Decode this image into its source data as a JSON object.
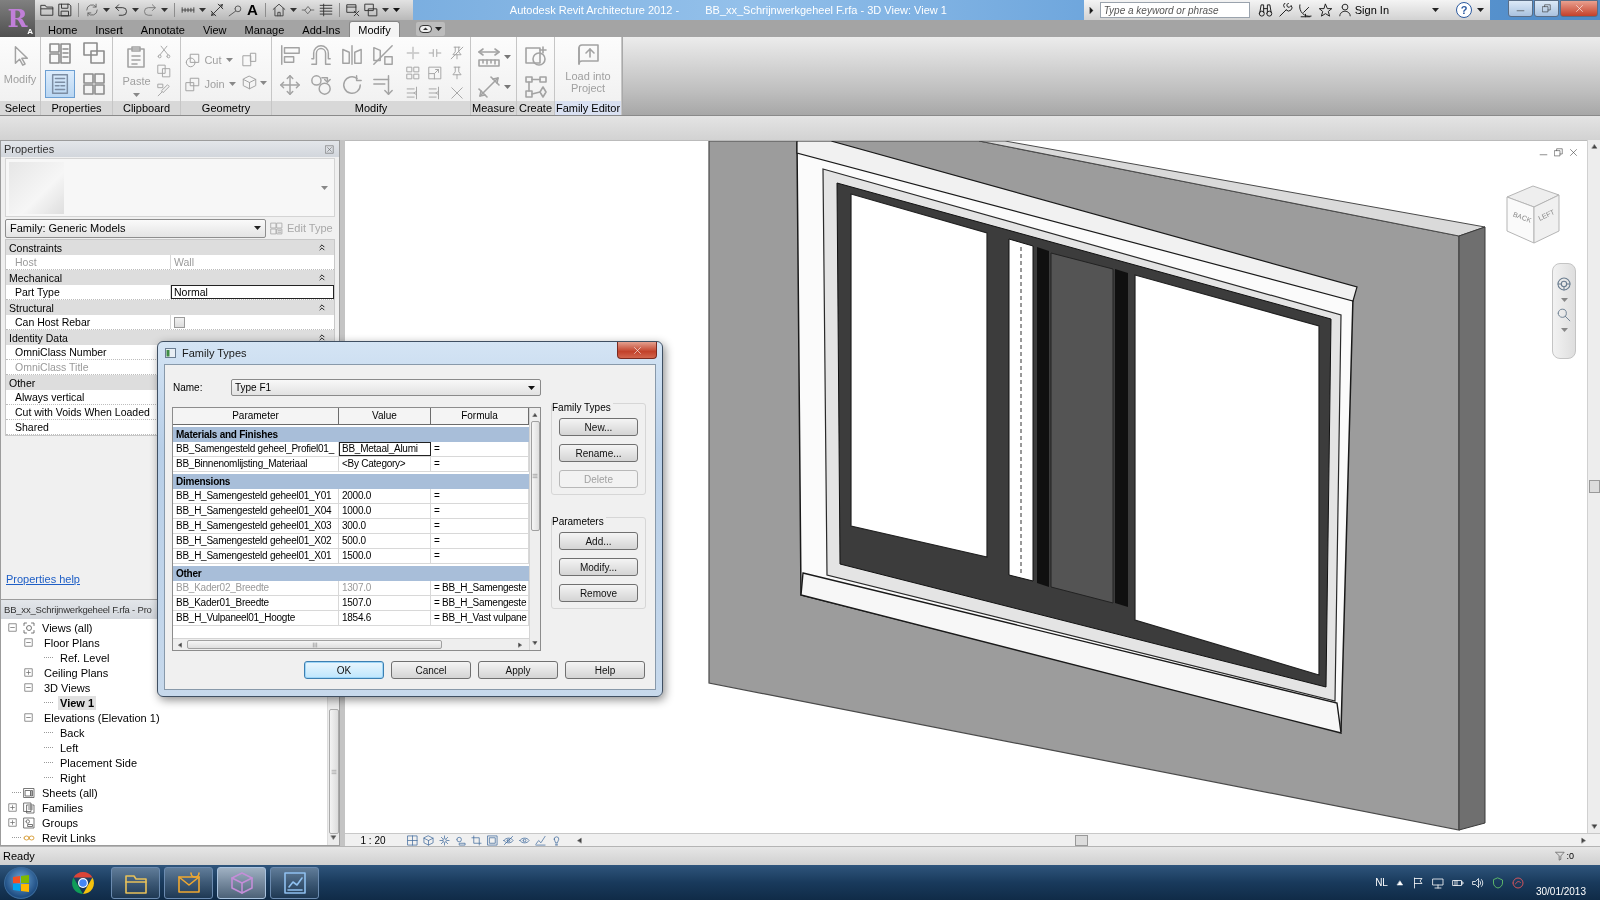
{
  "app_button": {
    "logo": "R",
    "key_tip": "A"
  },
  "quick_access": {
    "text_tool": "A"
  },
  "window": {
    "title_app": "Autodesk Revit Architecture 2012 -",
    "title_document": "BB_xx_Schrijnwerkgeheel F.rfa - 3D View: View 1"
  },
  "info_center": {
    "search": {
      "placeholder": "Type a keyword or phrase"
    },
    "sign_in": "Sign In",
    "help_symbol": "?"
  },
  "ribbon": {
    "tabs": [
      {
        "label": "Home",
        "selected": false
      },
      {
        "label": "Insert",
        "selected": false
      },
      {
        "label": "Annotate",
        "selected": false
      },
      {
        "label": "View",
        "selected": false
      },
      {
        "label": "Manage",
        "selected": false
      },
      {
        "label": "Add-Ins",
        "selected": false
      },
      {
        "label": "Modify",
        "selected": true
      }
    ],
    "panels": [
      {
        "label": "Select",
        "kind": "select",
        "contextual": false,
        "tools": [
          {
            "label": "Modify",
            "disabled": true
          }
        ]
      },
      {
        "label": "Properties",
        "kind": "properties",
        "contextual": false,
        "toggle_on": true
      },
      {
        "label": "Clipboard",
        "kind": "clipboard",
        "contextual": false,
        "tools": [
          {
            "label": "Paste",
            "disabled": true
          }
        ]
      },
      {
        "label": "Geometry",
        "kind": "geometry",
        "contextual": false,
        "tools": [
          {
            "label": "Cut",
            "disabled": true
          },
          {
            "label": "Join",
            "disabled": true
          }
        ]
      },
      {
        "label": "Modify",
        "kind": "modify",
        "contextual": false
      },
      {
        "label": "Measure",
        "kind": "measure",
        "contextual": false
      },
      {
        "label": "Create",
        "kind": "create",
        "contextual": false
      },
      {
        "label": "Family Editor",
        "kind": "family-editor",
        "contextual": true,
        "tools": [
          {
            "label": "Load into Project",
            "disabled": true
          }
        ]
      }
    ]
  },
  "properties": {
    "title": "Properties",
    "type_selector": "Family: Generic Models",
    "edit_type": {
      "label": "Edit Type",
      "disabled": true
    },
    "groups": [
      {
        "name": "Constraints",
        "expanded": true,
        "rows": [
          {
            "label": "Host",
            "kind": "text",
            "value": "Wall",
            "disabled": true
          }
        ]
      },
      {
        "name": "Mechanical",
        "expanded": true,
        "rows": [
          {
            "label": "Part Type",
            "kind": "field",
            "value": "Normal",
            "disabled": false
          }
        ]
      },
      {
        "name": "Structural",
        "expanded": true,
        "rows": [
          {
            "label": "Can Host Rebar",
            "kind": "checkbox",
            "checked": false,
            "disabled": false
          }
        ]
      },
      {
        "name": "Identity Data",
        "expanded": true,
        "rows": [
          {
            "label": "OmniClass Number",
            "kind": "text",
            "disabled": false
          },
          {
            "label": "OmniClass Title",
            "kind": "text",
            "disabled": true
          }
        ]
      },
      {
        "name": "Other",
        "expanded": true,
        "rows": [
          {
            "label": "Always vertical",
            "kind": "text",
            "disabled": false
          },
          {
            "label": "Cut with Voids When Loaded",
            "kind": "text",
            "disabled": false
          },
          {
            "label": "Shared",
            "kind": "text",
            "disabled": false
          }
        ]
      }
    ],
    "help_link": "Properties help"
  },
  "project_browser": {
    "title": "BB_xx_Schrijnwerkgeheel F.rfa - Pro",
    "tree": [
      {
        "label": "Views (all)",
        "kind": "views",
        "expanded": true,
        "children": [
          {
            "label": "Floor Plans",
            "expanded": true,
            "children": [
              {
                "label": "Ref. Level",
                "selected": false
              }
            ]
          },
          {
            "label": "Ceiling Plans",
            "expanded": false
          },
          {
            "label": "3D Views",
            "expanded": true,
            "children": [
              {
                "label": "View 1",
                "selected": true
              }
            ]
          },
          {
            "label": "Elevations (Elevation 1)",
            "expanded": true,
            "children": [
              {
                "label": "Back",
                "selected": false
              },
              {
                "label": "Left",
                "selected": false
              },
              {
                "label": "Placement Side",
                "selected": false
              },
              {
                "label": "Right",
                "selected": false
              }
            ]
          }
        ]
      },
      {
        "label": "Sheets (all)",
        "kind": "sheets"
      },
      {
        "label": "Families",
        "kind": "families",
        "expanded": false
      },
      {
        "label": "Groups",
        "kind": "groups",
        "expanded": false
      },
      {
        "label": "Revit Links",
        "kind": "links"
      }
    ]
  },
  "family_types_dialog": {
    "title": "Family Types",
    "name_label": "Name:",
    "name_value": "Type F1",
    "columns": [
      "Parameter",
      "Value",
      "Formula"
    ],
    "groups": [
      {
        "name": "Materials and Finishes",
        "rows": [
          {
            "parameter": "BB_Samengesteld geheel_Profiel01_",
            "value": "BB_Metaal_Alumi",
            "formula": "=",
            "focused": true,
            "disabled": false
          },
          {
            "parameter": "BB_Binnenomlijsting_Materiaal",
            "value": "<By Category>",
            "formula": "=",
            "focused": false,
            "disabled": false
          }
        ]
      },
      {
        "name": "Dimensions",
        "rows": [
          {
            "parameter": "BB_H_Samengesteld geheel01_Y01",
            "value": "2000.0",
            "formula": "=",
            "focused": false,
            "disabled": false
          },
          {
            "parameter": "BB_H_Samengesteld geheel01_X04",
            "value": "1000.0",
            "formula": "=",
            "focused": false,
            "disabled": false
          },
          {
            "parameter": "BB_H_Samengesteld geheel01_X03",
            "value": "300.0",
            "formula": "=",
            "focused": false,
            "disabled": false
          },
          {
            "parameter": "BB_H_Samengesteld geheel01_X02",
            "value": "500.0",
            "formula": "=",
            "focused": false,
            "disabled": false
          },
          {
            "parameter": "BB_H_Samengesteld geheel01_X01",
            "value": "1500.0",
            "formula": "=",
            "focused": false,
            "disabled": false
          }
        ]
      },
      {
        "name": "Other",
        "rows": [
          {
            "parameter": "BB_Kader02_Breedte",
            "value": "1307.0",
            "formula": "= BB_H_Samengeste",
            "focused": false,
            "disabled": true
          },
          {
            "parameter": "BB_Kader01_Breedte",
            "value": "1507.0",
            "formula": "= BB_H_Samengeste",
            "focused": false,
            "disabled": false
          },
          {
            "parameter": "BB_H_Vulpaneel01_Hoogte",
            "value": "1854.6",
            "formula": "= BB_H_Vast vulpane",
            "focused": false,
            "disabled": false
          }
        ]
      }
    ],
    "family_types_box": {
      "label": "Family Types",
      "buttons": [
        {
          "label": "New...",
          "disabled": false
        },
        {
          "label": "Rename...",
          "disabled": false
        },
        {
          "label": "Delete",
          "disabled": true
        }
      ]
    },
    "parameters_box": {
      "label": "Parameters",
      "buttons": [
        {
          "label": "Add...",
          "disabled": false
        },
        {
          "label": "Modify...",
          "disabled": false
        },
        {
          "label": "Remove",
          "disabled": false
        }
      ]
    },
    "buttons": [
      {
        "label": "OK",
        "default": true
      },
      {
        "label": "Cancel",
        "default": false
      },
      {
        "label": "Apply",
        "default": false
      },
      {
        "label": "Help",
        "default": false
      }
    ]
  },
  "view": {
    "scale": "1 : 20",
    "viewcube_faces": [
      "BACK",
      "LEFT"
    ]
  },
  "status_bar": {
    "text": "Ready",
    "filter_count": ":0"
  },
  "taskbar": {
    "apps": [
      {
        "kind": "browser",
        "running": false,
        "active": false
      },
      {
        "kind": "folder",
        "running": true,
        "active": false
      },
      {
        "kind": "mail",
        "running": true,
        "active": false
      },
      {
        "kind": "revit",
        "running": true,
        "active": true
      },
      {
        "kind": "chart",
        "running": true,
        "active": false
      }
    ],
    "tray": {
      "language": "NL",
      "date": "30/01/2013"
    }
  }
}
